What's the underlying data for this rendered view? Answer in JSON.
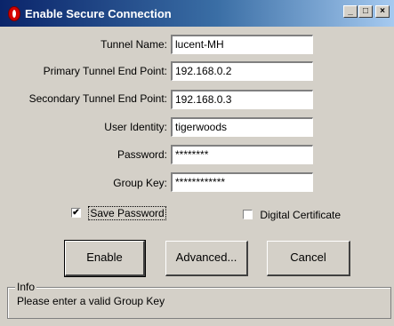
{
  "window": {
    "title": "Enable Secure Connection",
    "controls": {
      "minimize": "_",
      "maximize": "□",
      "close": "×"
    }
  },
  "fields": [
    {
      "label": "Tunnel Name:",
      "value": "lucent-MH"
    },
    {
      "label": "Primary Tunnel End Point:",
      "value": "192.168.0.2"
    },
    {
      "label": "Secondary Tunnel End Point:",
      "value": "192.168.0.3"
    },
    {
      "label": "User Identity:",
      "value": "tigerwoods"
    },
    {
      "label": "Password:",
      "value": "********"
    },
    {
      "label": "Group Key:",
      "value": "************"
    }
  ],
  "options": {
    "save_password": {
      "label": "Save Password",
      "checked": true,
      "mark": "✔"
    },
    "digital_certificate": {
      "label": "Digital Certificate",
      "checked": false,
      "mark": ""
    }
  },
  "buttons": {
    "enable": "Enable",
    "advanced": "Advanced...",
    "cancel": "Cancel"
  },
  "info": {
    "title": "Info",
    "message": "Please enter a valid Group Key"
  },
  "colors": {
    "titlebar_start": "#0a246a",
    "titlebar_end": "#a6caf0",
    "dialog_bg": "#d4d0c8",
    "app_icon": "#d40000"
  },
  "icons": {
    "app": "opera-o-icon"
  }
}
